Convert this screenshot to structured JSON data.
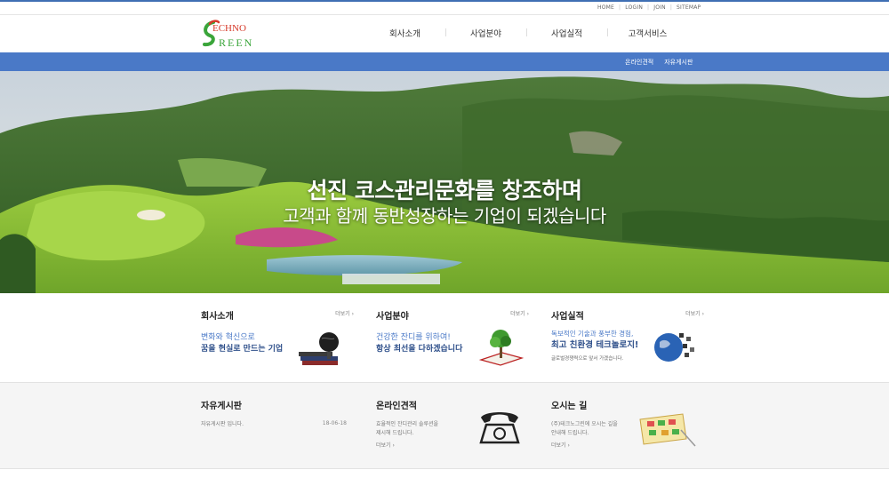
{
  "top_links": [
    "HOME",
    "LOGIN",
    "JOIN",
    "SITEMAP"
  ],
  "logo": {
    "line1": "ECHNO",
    "line2": "REEN",
    "initial1": "T",
    "initial2": "G"
  },
  "gnb": [
    "회사소개",
    "사업분야",
    "사업실적",
    "고객서비스"
  ],
  "sub_links": [
    "온라인견적",
    "자유게시판"
  ],
  "hero": {
    "line1": "선진 코스관리문화를 창조하며",
    "line2": "고객과 함께 동반성장하는 기업이 되겠습니다"
  },
  "row1": [
    {
      "title": "회사소개",
      "more": "더보기",
      "line1": "변화와 혁신으로",
      "line2": "꿈을 현실로 만드는 기업",
      "icon": "globe-books-icon"
    },
    {
      "title": "사업분야",
      "more": "더보기",
      "line1": "건강한 잔디를 위하여!",
      "line2": "항상 최선을 다하겠습니다",
      "icon": "tree-book-icon"
    },
    {
      "title": "사업실적",
      "more": "더보기",
      "line1": "독보적인 기술과 풍부한 경험,",
      "line2": "최고 친환경 테크놀로지!",
      "line3": "글로벌경쟁력으로 앞서 가겠습니다.",
      "icon": "earth-icon"
    }
  ],
  "row2": [
    {
      "title": "자유게시판",
      "desc": "자유게시판 입니다.",
      "date": "18-06-18"
    },
    {
      "title": "온라인견적",
      "desc1": "효율적인 잔디관리 솔루션을",
      "desc2": "제시해 드립니다.",
      "more": "더보기",
      "icon": "telephone-icon"
    },
    {
      "title": "오시는 길",
      "desc1": "(주)테크노그린에 오시는 길을",
      "desc2": "안내해 드립니다.",
      "more": "더보기",
      "icon": "map-icon"
    }
  ],
  "colors": {
    "accent": "#4a79c7",
    "dark_blue": "#2e4f8a",
    "logo_green": "#3aa53a",
    "logo_red": "#d63a2a"
  }
}
